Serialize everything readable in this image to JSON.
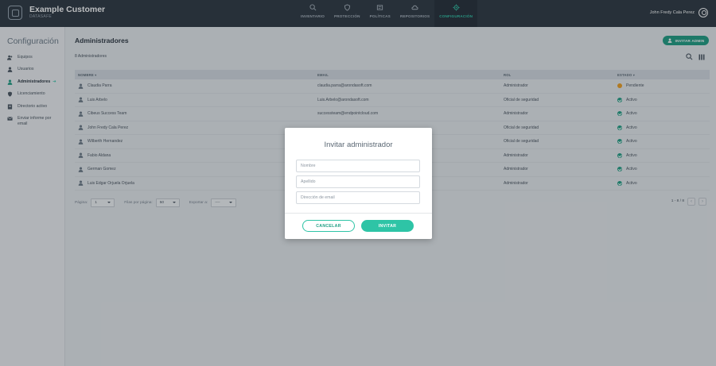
{
  "app": {
    "title": "Example Customer",
    "subtitle": "DATASAFE"
  },
  "nav": [
    {
      "label": "INVENTARIO",
      "icon": "inventory-icon",
      "active": false
    },
    {
      "label": "PROTECCIÓN",
      "icon": "shield-icon",
      "active": false
    },
    {
      "label": "POLÍTICAS",
      "icon": "policies-icon",
      "active": false
    },
    {
      "label": "REPOSITORIOS",
      "icon": "cloud-icon",
      "active": false
    },
    {
      "label": "CONFIGURACIÓN",
      "icon": "gear-icon",
      "active": true
    }
  ],
  "user": {
    "name": "John Fredy Cala Perez"
  },
  "sidebar": {
    "title": "Configuración",
    "items": [
      {
        "label": "Equipos",
        "icon": "users-group-icon"
      },
      {
        "label": "Usuarios",
        "icon": "user-icon"
      },
      {
        "label": "Administradores",
        "icon": "admin-icon",
        "active": true
      },
      {
        "label": "Licenciamiento",
        "icon": "license-shield-icon"
      },
      {
        "label": "Directorio activo",
        "icon": "directory-icon"
      },
      {
        "label": "Enviar informe por email",
        "icon": "mail-icon"
      }
    ]
  },
  "main": {
    "title": "Administradores",
    "invite_label": "INVITAR ADMIN",
    "count_label": "8 Administradores",
    "columns": {
      "name": "NOMBRE",
      "email": "EMAIL",
      "role": "ROL",
      "status": "ESTADO"
    },
    "rows": [
      {
        "name": "Claudia Parra",
        "email": "claudia.parra@arondasoft.com",
        "role": "Administrador",
        "status": "Pendiente",
        "status_kind": "pending"
      },
      {
        "name": "Luis Arbelo",
        "email": "Luis.Arbelo@arondasoft.com",
        "role": "Oficial de seguridad",
        "status": "Activo",
        "status_kind": "active"
      },
      {
        "name": "Cibeus Success Team",
        "email": "successteam@endpointcloud.com",
        "role": "Administrador",
        "status": "Activo",
        "status_kind": "active"
      },
      {
        "name": "John Fredy Cala Perez",
        "email": "",
        "role": "Oficial de seguridad",
        "status": "Activo",
        "status_kind": "active"
      },
      {
        "name": "Wilberth Hernandez",
        "email": "",
        "role": "Oficial de seguridad",
        "status": "Activo",
        "status_kind": "active"
      },
      {
        "name": "Fabio Aldana",
        "email": "",
        "role": "Administrador",
        "status": "Activo",
        "status_kind": "active"
      },
      {
        "name": "German Gomez",
        "email": "",
        "role": "Administrador",
        "status": "Activo",
        "status_kind": "active"
      },
      {
        "name": "Luis Edgar Orjuela Orjuela",
        "email": "",
        "role": "Administrador",
        "status": "Activo",
        "status_kind": "active"
      }
    ],
    "pager": {
      "page_label": "Página:",
      "page_value": "1",
      "rows_label": "Filas por página:",
      "rows_value": "50",
      "export_label": "Exportar a:",
      "export_value": "----",
      "range": "1 - 8 / 8"
    }
  },
  "modal": {
    "title": "Invitar administrador",
    "fields": [
      {
        "name": "first-name-field",
        "placeholder": "Nombre",
        "value": ""
      },
      {
        "name": "last-name-field",
        "placeholder": "Apellido",
        "value": ""
      },
      {
        "name": "email-field",
        "placeholder": "Dirección de email",
        "value": ""
      }
    ],
    "cancel_label": "CANCELAR",
    "invite_label": "INVITAR"
  },
  "colors": {
    "accent": "#2ec4a6",
    "accent_dark": "#1e9e83",
    "topbar": "#2c3640",
    "pending": "#f0a020"
  }
}
